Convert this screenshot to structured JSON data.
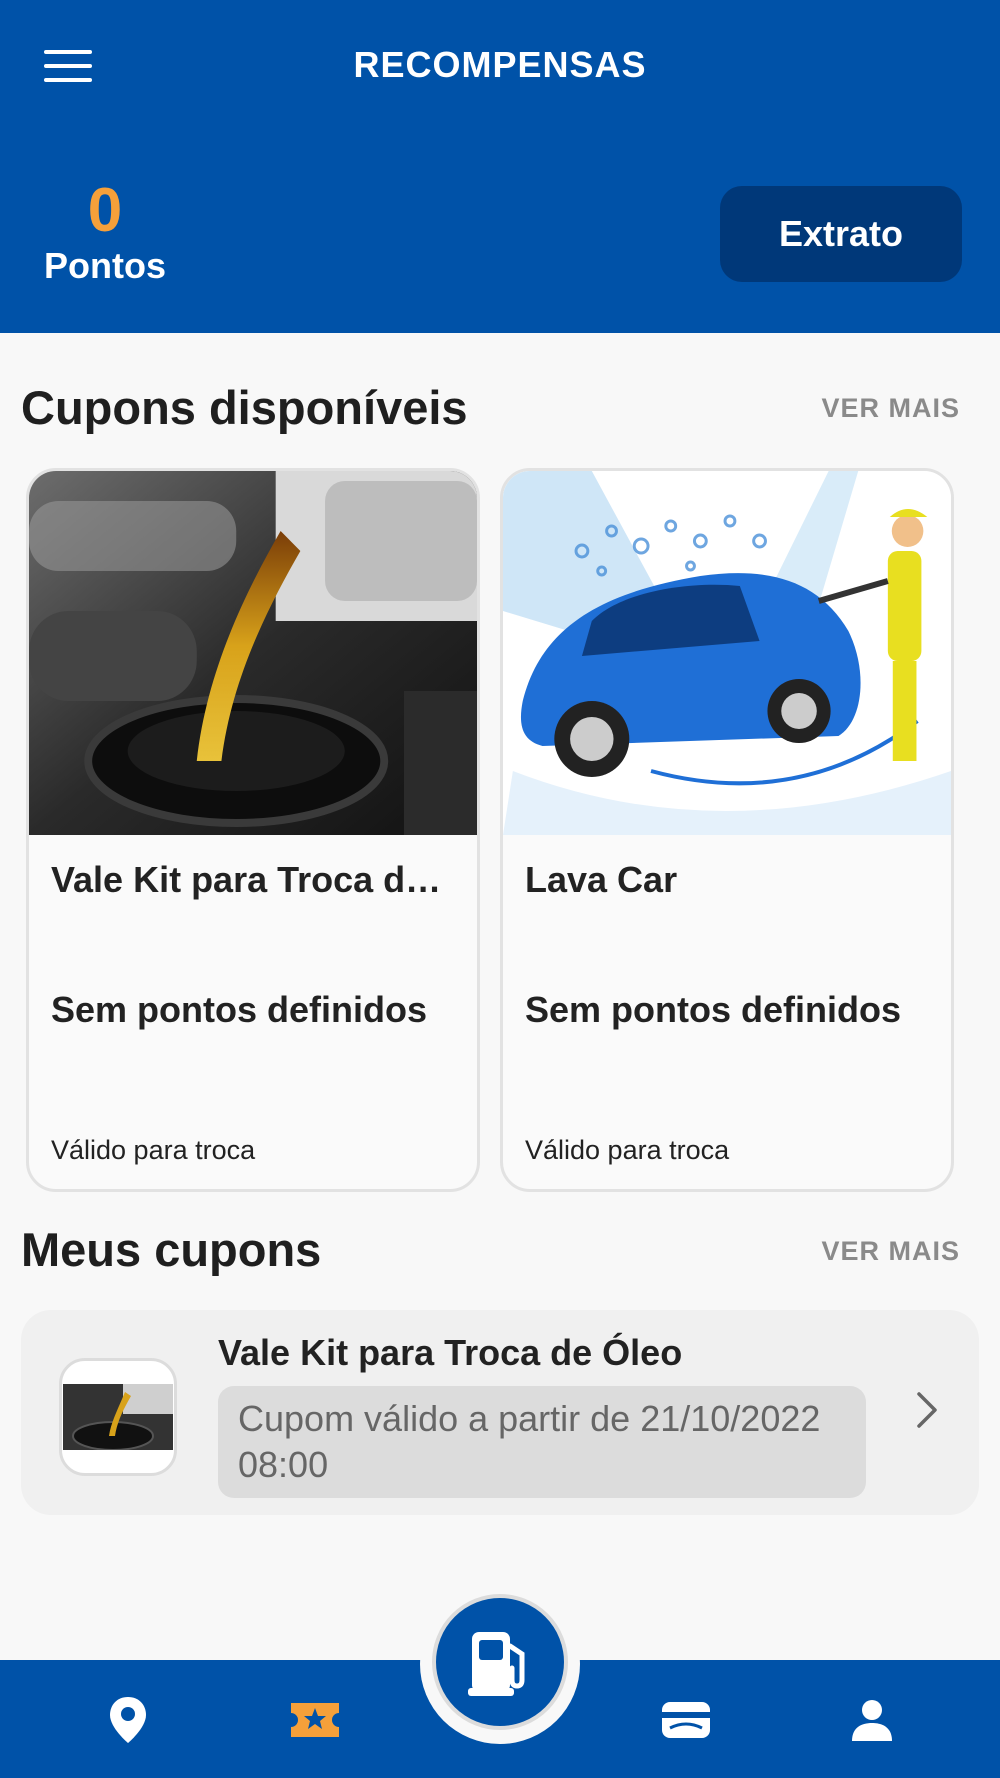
{
  "header": {
    "title": "RECOMPENSAS",
    "points_value": "0",
    "points_label": "Pontos",
    "extrato_label": "Extrato"
  },
  "available": {
    "title": "Cupons disponíveis",
    "see_more": "VER MAIS",
    "cards": [
      {
        "title": "Vale Kit para Troca de Óleo",
        "points": "Sem pontos definidos",
        "valid": "Válido para troca"
      },
      {
        "title": "Lava Car",
        "points": "Sem pontos definidos",
        "valid": "Válido para troca"
      }
    ]
  },
  "mine": {
    "title": "Meus cupons",
    "see_more": "VER MAIS",
    "coupon": {
      "title": "Vale Kit para Troca de Óleo",
      "status": "Cupom válido a partir de 21/10/2022 08:00"
    }
  },
  "colors": {
    "primary": "#0052a8",
    "dark_button": "#003879",
    "accent_orange": "#f5a03a"
  },
  "bottom_nav": [
    "map-pin-icon",
    "coupon-star-icon",
    "fuel-pump-icon",
    "card-icon",
    "person-icon"
  ]
}
